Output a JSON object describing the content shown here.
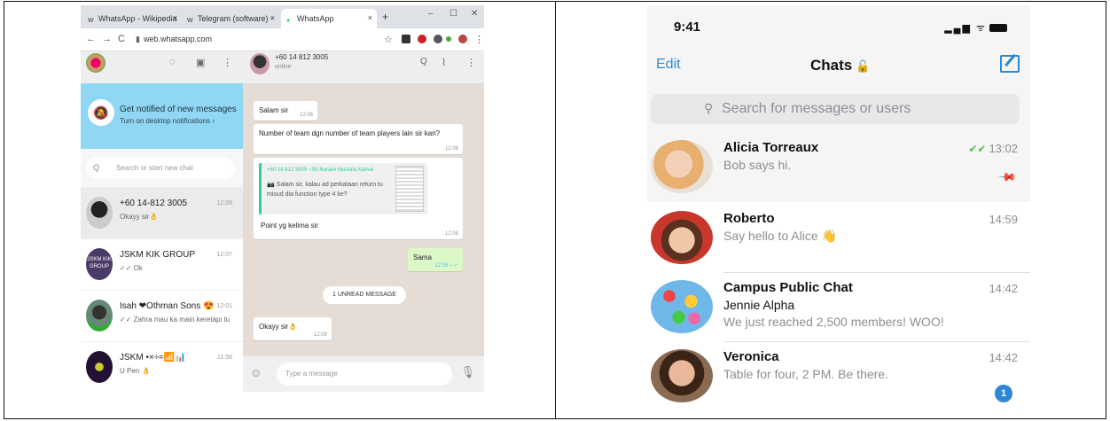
{
  "browser": {
    "tabs": [
      {
        "label": "Wikipedia",
        "full": "WhatsApp - Wikipedia",
        "icon": "W"
      },
      {
        "label": "Telegram (software) -",
        "icon": "W"
      },
      {
        "label": "WhatsApp",
        "icon": "●"
      }
    ],
    "new_tab": "+",
    "win_min": "–",
    "win_max": "☐",
    "win_close": "✕",
    "tab_close": "×",
    "back": "←",
    "forward": "→",
    "reload": "C",
    "url": "web.whatsapp.com",
    "star": "☆"
  },
  "whatsapp": {
    "header_icons": {
      "status": "◌",
      "chat": "▣",
      "menu": "⋮"
    },
    "notify_title": "Get notified of new messages",
    "notify_sub": "Turn on desktop notifications ›",
    "search_placeholder": "Search or start new chat",
    "search_icon": "Q",
    "chats": [
      {
        "name": "+60 14-812 3005",
        "time": "12:09",
        "preview": "Okayy sir👌"
      },
      {
        "name": "JSKM KIK GROUP",
        "time": "12:07",
        "preview": "✓✓ Ok",
        "avatar_text": "JSKM KIK GROUP"
      },
      {
        "name": "Isah ❤Othman Sons 😍",
        "time": "12:01",
        "preview": "✓✓ Zahra mau ka main keretapi tu"
      },
      {
        "name": "JSKM •×÷≈📶📊",
        "time": "11:56",
        "preview": "U Pen 👌"
      }
    ],
    "conversation": {
      "contact_name": "+60 14 812 3005",
      "status": "online",
      "messages": [
        {
          "text": "Salam sir",
          "time": "12:06"
        },
        {
          "text": "Number of team dgn number of team players lain sir kan?",
          "time": "12:06"
        },
        {
          "quote_header": "+60 14 812 3005  ~Sh Nuraini Mustafa Kamal",
          "quote_text": "📷 Salam sir, kalau ad perkataan return tu misud dia function type 4 ke?",
          "text": "Point yg kelima sir",
          "time": "12:08"
        },
        {
          "text": "Sama",
          "time": "12:08 ✓✓"
        },
        {
          "text": "Okayy sir👌",
          "time": "12:09"
        }
      ],
      "unread_label": "1 UNREAD MESSAGE",
      "compose_placeholder": "Type a message",
      "emoji_icon": "☺",
      "mic_icon": "🎙"
    }
  },
  "telegram": {
    "status_time": "9:41",
    "status_icons": "▂▄▆ ᯤ",
    "edit_label": "Edit",
    "title": "Chats",
    "title_lock": "🔓",
    "search_icon": "⚲",
    "search_placeholder": "Search for messages or users",
    "chats": [
      {
        "name": "Alicia Torreaux",
        "time": "13:02",
        "check": "✔✔",
        "preview": "Bob says hi.",
        "pinned_icon": "📌"
      },
      {
        "name": "Roberto",
        "time": "14:59",
        "preview": "Say hello to Alice 👋"
      },
      {
        "name": "Campus Public Chat",
        "time": "14:42",
        "sender": "Jennie Alpha",
        "preview": "We just reached 2,500 members! WOO!"
      },
      {
        "name": "Veronica",
        "time": "14:42",
        "preview": "Table for four, 2 PM. Be there.",
        "badge": "1"
      }
    ]
  }
}
